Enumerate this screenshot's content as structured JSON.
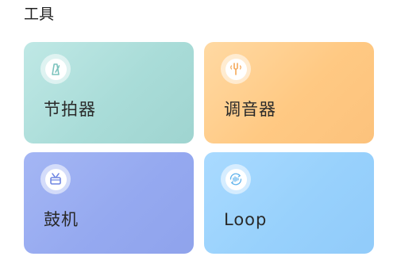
{
  "section": {
    "title": "工具"
  },
  "tools": [
    {
      "label": "节拍器",
      "icon": "metronome-icon",
      "color": "#a9dcd8",
      "icon_color": "#7cc3bd"
    },
    {
      "label": "调音器",
      "icon": "tuning-fork-icon",
      "color": "#ffc983",
      "icon_color": "#f4a85a"
    },
    {
      "label": "鼓机",
      "icon": "drum-icon",
      "color": "#95a9f0",
      "icon_color": "#6f86e2"
    },
    {
      "label": "Loop",
      "icon": "loop-icon",
      "color": "#98d1fc",
      "icon_color": "#5fb2ec"
    }
  ]
}
